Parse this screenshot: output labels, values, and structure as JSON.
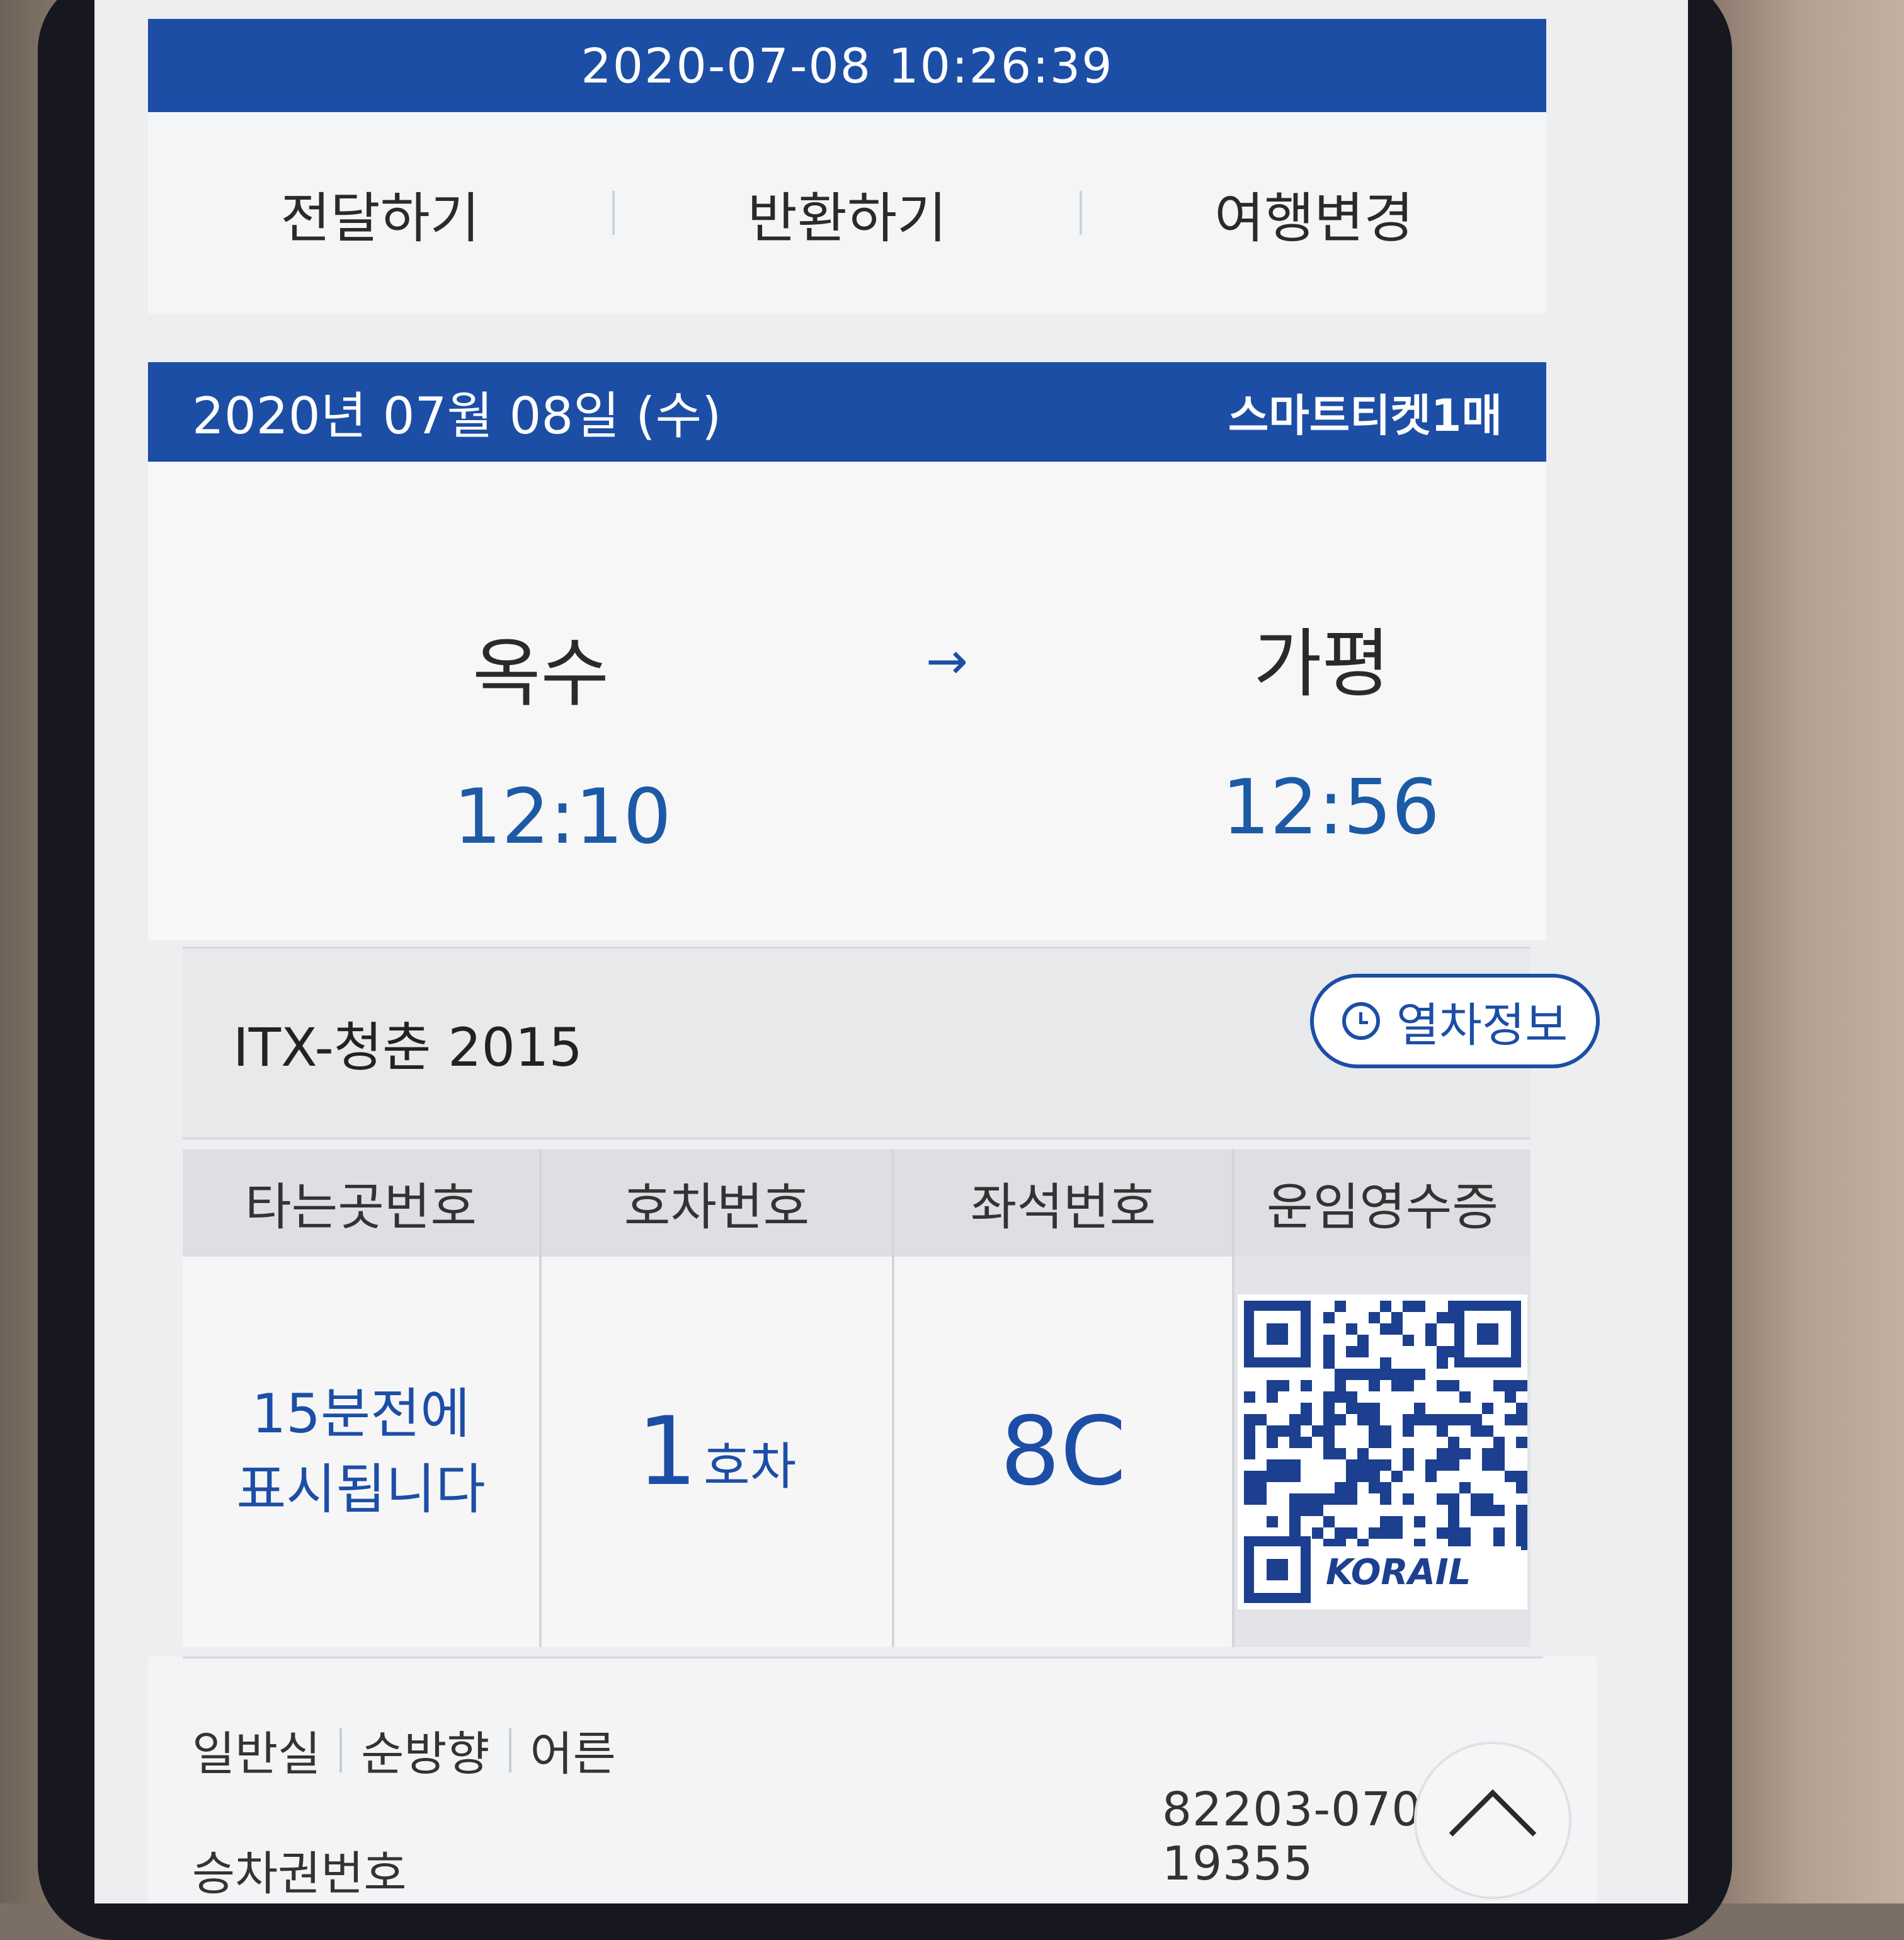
{
  "status": {
    "timestamp": "2020-07-08 10:26:39"
  },
  "actions": [
    "전달하기",
    "반환하기",
    "여행변경"
  ],
  "ticket": {
    "date": "2020년 07월 08일 (수)",
    "count_label": "스마트티켓1매",
    "departure": {
      "station": "옥수",
      "time": "12:10"
    },
    "arrival": {
      "station": "가평",
      "time": "12:56"
    },
    "arrow_glyph": "→",
    "train_name": "ITX-청춘 2015",
    "train_info_button": "열차정보",
    "grid": {
      "headers": [
        "타는곳번호",
        "호차번호",
        "좌석번호",
        "운임영수증"
      ],
      "platform_notice": "15분전에\n표시됩니다",
      "car_number": "1",
      "car_unit": "호차",
      "seat": "8C",
      "qr_brand": "KORAIL"
    },
    "class_info": [
      "일반실",
      "순방향",
      "어른"
    ],
    "ticket_no_label": "승차권번호",
    "ticket_no": "82203-0708-19355"
  },
  "colors": {
    "accent": "#1c4ea6",
    "accent_text": "#1c5aa6"
  },
  "icons": {
    "train_info": "clock-icon",
    "scroll_top": "chevron-up-icon"
  }
}
